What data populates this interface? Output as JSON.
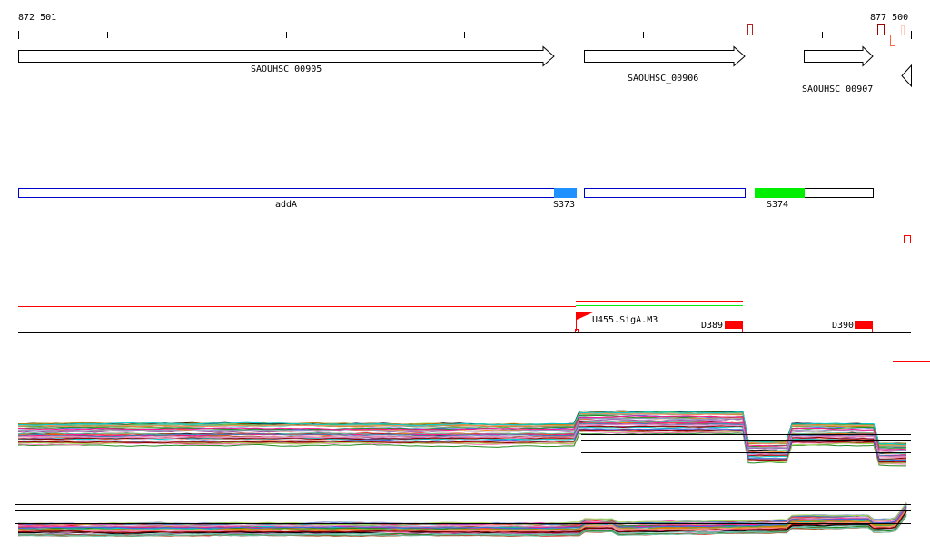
{
  "ruler": {
    "start_label": "872 501",
    "end_label": "877 500"
  },
  "genes": [
    {
      "name": "SAOUHSC_00905",
      "strand": "+"
    },
    {
      "name": "SAOUHSC_00906",
      "strand": "+"
    },
    {
      "name": "SAOUHSC_00907",
      "strand": "+"
    }
  ],
  "operons": {
    "addA": "addA",
    "s373": "S373",
    "s374": "S374"
  },
  "features": {
    "promoter": "U455.SigA.M3",
    "d389": "D389",
    "d390": "D390"
  },
  "colors": {
    "blue_fill": "#1e90ff",
    "green": "#00ee00",
    "red": "#ff0000",
    "operon_outline": "#0000cc"
  },
  "expression_colors": [
    "#000000",
    "#e41a1c",
    "#377eb8",
    "#4daf4a",
    "#984ea3",
    "#ff7f00",
    "#a65628",
    "#f781bf",
    "#999999",
    "#66c2a5",
    "#fc8d62",
    "#8da0cb",
    "#e78ac3",
    "#a6d854",
    "#b8860b",
    "#00ced1",
    "#8b0000",
    "#228b22",
    "#ff1493",
    "#4169e1"
  ]
}
